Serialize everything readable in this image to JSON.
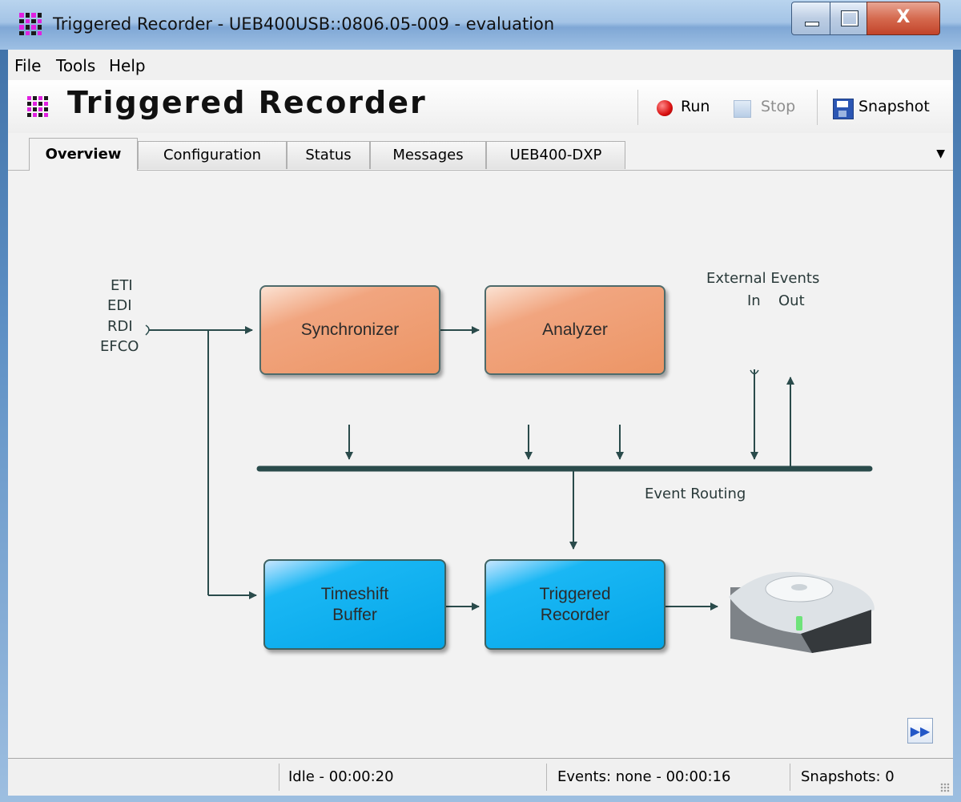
{
  "window": {
    "title": "Triggered Recorder - UEB400USB::0806.05-009 - evaluation",
    "close_glyph": "X"
  },
  "menu": [
    "File",
    "Tools",
    "Help"
  ],
  "header": {
    "app_name": "Triggered Recorder",
    "run_label": "Run",
    "stop_label": "Stop",
    "snapshot_label": "Snapshot"
  },
  "tabs": [
    {
      "label": "Overview",
      "active": true
    },
    {
      "label": "Configuration"
    },
    {
      "label": "Status"
    },
    {
      "label": "Messages"
    },
    {
      "label": "UEB400-DXP"
    }
  ],
  "tab_overflow_glyph": "▼",
  "diagram": {
    "inputs": [
      "ETI",
      "EDI",
      "RDI",
      "EFCO"
    ],
    "external_events_label": "External Events",
    "in_label": "In",
    "out_label": "Out",
    "event_routing_label": "Event Routing",
    "blocks": {
      "synchronizer": "Synchronizer",
      "analyzer": "Analyzer",
      "timeshift_buffer": "Timeshift\nBuffer",
      "triggered_recorder": "Triggered\nRecorder"
    },
    "colors": {
      "line": "#2a4b4b",
      "orange_block": "#ec9565",
      "blue_block": "#04a6e8"
    }
  },
  "fast_forward_glyph": "▶▶",
  "status": {
    "state": "Idle - 00:00:20",
    "events": "Events: none - 00:00:16",
    "snapshots": "Snapshots: 0"
  }
}
